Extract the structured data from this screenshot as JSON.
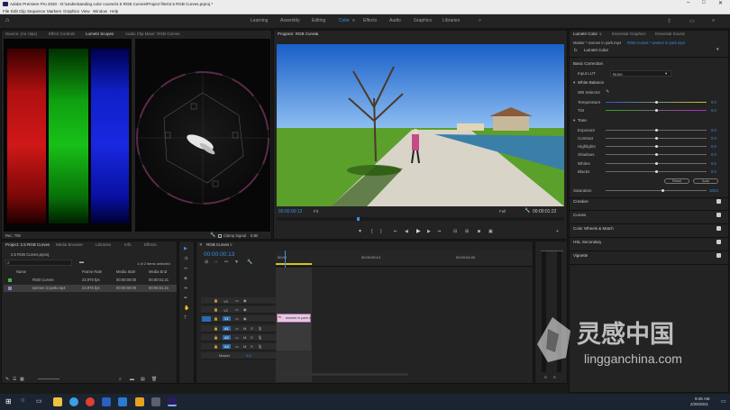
{
  "window": {
    "title": "Adobe Premiere Pro 2020 - D:\\Understanding color course\\2.5 RGB Curves\\Project files\\2.5 RGB Curves.prproj *"
  },
  "menu": [
    "File",
    "Edit",
    "Clip",
    "Sequence",
    "Markers",
    "Graphics",
    "View",
    "Window",
    "Help"
  ],
  "workspaces": [
    "Learning",
    "Assembly",
    "Editing",
    "Color",
    "Effects",
    "Audio",
    "Graphics",
    "Libraries"
  ],
  "active_workspace": "Color",
  "source_panel": {
    "tabs": [
      "Source: (no clips)",
      "Effect Controls",
      "Lumetri Scopes",
      "Audio Clip Mixer: RGB Curves"
    ],
    "active_tab": "Lumetri Scopes",
    "footer": "Rec. 709",
    "clamp_label": "Clamp Signal",
    "bit_depth": "8 Bit"
  },
  "program": {
    "title": "Program: RGB Curves",
    "timecode_current": "00:00:00:13",
    "fit": "Fit",
    "resolution": "Full",
    "timecode_duration": "00:00:01:22"
  },
  "lumetri": {
    "tabs": [
      "Lumetri Color",
      "Essential Graphics",
      "Essential Sound"
    ],
    "master": "Master * women in park.mp4",
    "clip": "RGB Curves * women in park.mp4",
    "fx_name": "Lumetri Color",
    "basic_correction": "Basic Correction",
    "input_lut_label": "Input LUT",
    "input_lut_value": "None",
    "white_balance": "White Balance",
    "wb_selector": "WB Selector",
    "temperature_label": "Temperature",
    "temperature_value": "0.0",
    "tint_label": "Tint",
    "tint_value": "0.0",
    "tone": "Tone",
    "tone_rows": [
      {
        "label": "Exposure",
        "value": "0.0"
      },
      {
        "label": "Contrast",
        "value": "0.0"
      },
      {
        "label": "Highlights",
        "value": "0.0"
      },
      {
        "label": "Shadows",
        "value": "0.0"
      },
      {
        "label": "Whites",
        "value": "0.0"
      },
      {
        "label": "Blacks",
        "value": "0.0"
      }
    ],
    "reset_label": "Reset",
    "auto_label": "Auto",
    "saturation_label": "Saturation",
    "saturation_value": "100.0",
    "sections": [
      "Creative",
      "Curves",
      "Color Wheels & Match",
      "HSL Secondary",
      "Vignette"
    ]
  },
  "project": {
    "tabs": [
      "Project: 2.5 RGB Curves",
      "Media Browser",
      "Libraries",
      "Info",
      "Effects"
    ],
    "file": "2.5 RGB Curves.prproj",
    "selection": "1 of 2 items selected",
    "columns": [
      "Name",
      "Frame Rate",
      "Media Start",
      "Media End"
    ],
    "rows": [
      {
        "name": "RGB Curves",
        "fps": "23.976 fps",
        "start": "00:00:00:00",
        "end": "00:00:01:21",
        "color": "#4caf50"
      },
      {
        "name": "women in park.mp4",
        "fps": "23.976 fps",
        "start": "00:00:00:00",
        "end": "00:00:01:21",
        "color": "#9c7ccc"
      }
    ]
  },
  "timeline": {
    "tab": "RGB Curves",
    "timecode": "00:00:00:13",
    "ruler": [
      "00:00",
      "00:00:00:12",
      "00:00:01:00"
    ],
    "video_tracks": [
      "V3",
      "V2",
      "V1"
    ],
    "audio_tracks": [
      "A1",
      "A2",
      "A3"
    ],
    "master_label": "Master",
    "master_value": "0.0",
    "clip_label": "women in park.m"
  },
  "audio_meter": {
    "labels": [
      "S",
      "S"
    ]
  },
  "taskbar": {
    "time": "9:46 AM",
    "date": "2/25/2021"
  },
  "watermark": {
    "text": "灵感中国",
    "url": "lingganchina.com"
  }
}
